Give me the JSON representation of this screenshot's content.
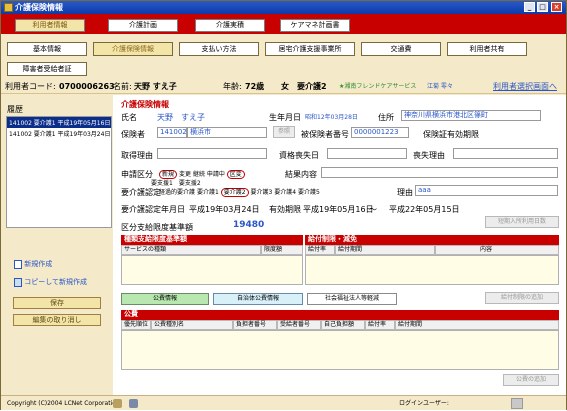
{
  "window": {
    "title": "介護保険情報",
    "min": "_",
    "max": "□",
    "close": "×"
  },
  "top_tabs": [
    "利用者情報",
    "介護計画",
    "介護実積",
    "ケアマネ計画書"
  ],
  "sub_tabs": [
    "基本情報",
    "介護保険情報",
    "支払い方法",
    "居宅介護支援事業所",
    "交通費",
    "利用者共有",
    "障害者受給者証"
  ],
  "info_bar": {
    "user_code_label": "利用者コード:",
    "user_code": "0700006263",
    "name_label": "名前:",
    "name": "天野 すえ子",
    "age_label": "年齢:",
    "age": "72歳",
    "sex": "女",
    "care_level": "要介護2",
    "provider": "★湘南フレンドケアサービス",
    "staff": "江菊 零々",
    "select_link": "利用者選択画面へ"
  },
  "history": {
    "label": "履歴",
    "items": [
      "141002 要介護1 平成19年05月16日",
      "141002 要介護1 平成19年03月24日"
    ],
    "selected": 0
  },
  "sidebar": {
    "new_label": "新規作成",
    "copy_label": "コピーして新規作成",
    "save_label": "保存",
    "cancel_label": "編集の取り消し"
  },
  "form": {
    "section_title": "介護保険情報",
    "name_label": "氏名",
    "name_value": "天野　すえ子",
    "birthday_label": "生年月日",
    "birthday_value": "昭和12年03月28日",
    "address_label": "住所",
    "address_value": "神奈川県横浜市港北区篠町",
    "insurer_label": "保険者",
    "insurer_code": "141002",
    "insurer_city": "横浜市",
    "insurer_btn": "参照",
    "insured_no_label": "被保険者番号",
    "insured_no": "0000001223",
    "insured_card_label": "保険証有効期限",
    "acquire_reason_label": "取得理由",
    "acquire_date_label": "資格喪失日",
    "lose_reason_label": "喪失理由",
    "app_div_label": "申請区分",
    "app_options": [
      "新規",
      "変更",
      "継続",
      "申請中",
      "区変"
    ],
    "result_label": "結果内容",
    "support_levels": "要支援1　要支援2",
    "cert_label": "要介護認定",
    "cert_options": [
      "経過的要介護",
      "要介護1",
      "要介護2",
      "要介護3",
      "要介護4",
      "要介護5"
    ],
    "reason_label": "理由",
    "reason_value": "aaa",
    "cert_date_label": "要介護認定年月日",
    "cert_date": "平成19年03月24日",
    "valid_label": "有効期限",
    "valid_from": "平成19年05月16日",
    "valid_sep": "～",
    "valid_to": "平成22年05月15日",
    "limit_label": "区分支給限度基準額",
    "limit_value": "19480",
    "calc_btn": "短期入所利用日数"
  },
  "limit_table": {
    "title": "種類支給限度基準額",
    "cols": [
      "サービスの種類",
      "限度額"
    ]
  },
  "restrict_table": {
    "title": "給付制限・減免",
    "cols": [
      "給付率",
      "給付期間",
      "内容"
    ]
  },
  "bottom_tabs": {
    "public": "公費情報",
    "local": "自治体公費情報",
    "welfare": "社会福祉法人等軽減",
    "restrict_btn": "給付制限の追加"
  },
  "public_table": {
    "title": "公費",
    "cols": [
      "優先順位",
      "公費種別名",
      "負担者番号",
      "受給者番号",
      "自己負担額",
      "給付率",
      "給付期間"
    ]
  },
  "add_public_btn": "公費の追加",
  "statusbar": {
    "copyright": "Copyright (C)2004 LCNet Corporation",
    "login": "ログインユーザー:"
  },
  "colors": {
    "red": "#c80000",
    "bg": "#f4e9c8",
    "blue": "#2a56c8"
  }
}
